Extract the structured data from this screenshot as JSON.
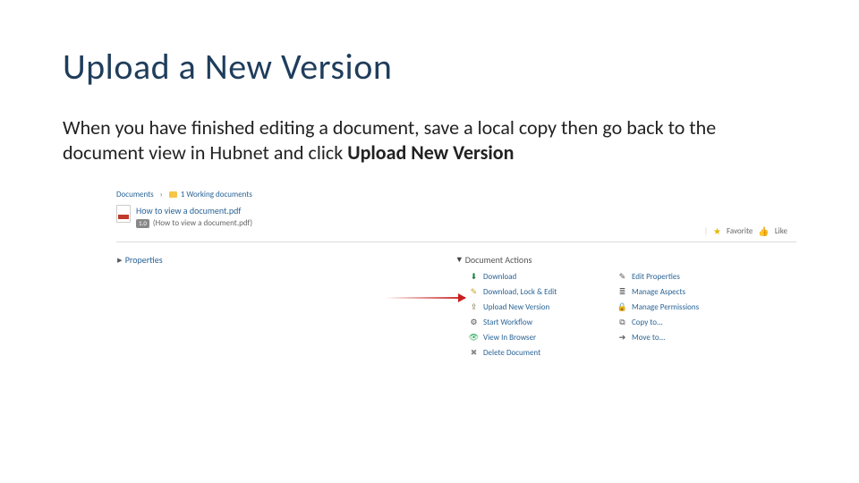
{
  "title": "Upload a New Version",
  "body_prefix": "When you have finished editing a document, save a local copy then go back to the document view in Hubnet and click ",
  "body_bold": "Upload New Version",
  "breadcrumb": {
    "root": "Documents",
    "folder": "1 Working documents"
  },
  "document": {
    "name": "How to view a document.pdf",
    "version": "1.0",
    "subname": "(How to view a document.pdf)"
  },
  "favorite_label": "Favorite",
  "like_label": "Like",
  "properties_label": "Properties",
  "actions_header": "Document Actions",
  "actions_col1": [
    {
      "icon": "download",
      "label": "Download"
    },
    {
      "icon": "edit",
      "label": "Download, Lock & Edit"
    },
    {
      "icon": "upload",
      "label": "Upload New Version"
    },
    {
      "icon": "workflow",
      "label": "Start Workflow"
    },
    {
      "icon": "browser",
      "label": "View In Browser"
    },
    {
      "icon": "delete",
      "label": "Delete Document"
    }
  ],
  "actions_col2": [
    {
      "icon": "props",
      "label": "Edit Properties"
    },
    {
      "icon": "aspects",
      "label": "Manage Aspects"
    },
    {
      "icon": "perms",
      "label": "Manage Permissions"
    },
    {
      "icon": "copy",
      "label": "Copy to..."
    },
    {
      "icon": "move",
      "label": "Move to..."
    }
  ],
  "icon_glyphs": {
    "download": "⬇",
    "edit": "✎",
    "upload": "⇪",
    "workflow": "⚙",
    "browser": "👁",
    "delete": "✖",
    "props": "✎",
    "aspects": "≣",
    "perms": "🔒",
    "copy": "⧉",
    "move": "➔"
  }
}
